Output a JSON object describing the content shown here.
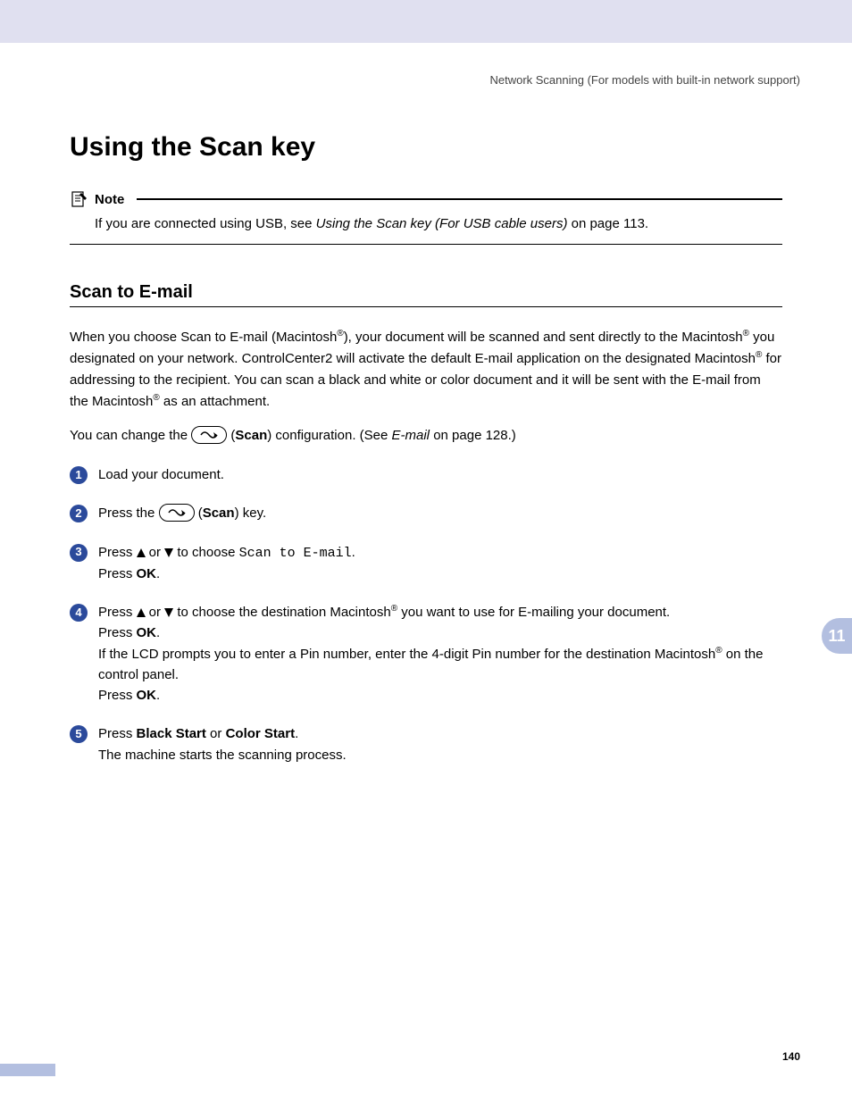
{
  "running_head": "Network Scanning (For models with built-in network support)",
  "title": "Using the Scan key",
  "note": {
    "label": "Note",
    "prefix": "If you are connected using USB, see ",
    "link": "Using the Scan key (For USB cable users)",
    "suffix": " on page 113."
  },
  "subheading": "Scan to E-mail",
  "para1": {
    "t1": "When you choose Scan to E-mail (Macintosh",
    "r1": "®",
    "t2": "), your document will be scanned and sent directly to the Macintosh",
    "r2": "®",
    "t3": " you designated on your network. ControlCenter2 will activate the default E-mail application on the designated Macintosh",
    "r3": "®",
    "t4": " for addressing to the recipient. You can scan a black and white or color document and it will be sent with the E-mail from the Macintosh",
    "r4": "®",
    "t5": " as an attachment."
  },
  "para2": {
    "t1": "You can change the ",
    "t2": " (",
    "scan": "Scan",
    "t3": ") configuration. (See ",
    "link": "E-mail",
    "t4": " on page 128.)"
  },
  "steps": {
    "s1": {
      "num": "1",
      "text": "Load your document."
    },
    "s2": {
      "num": "2",
      "t1": "Press the ",
      "t2": " (",
      "scan": "Scan",
      "t3": ") key."
    },
    "s3": {
      "num": "3",
      "t1": "Press ",
      "t2": " or ",
      "t3": " to choose ",
      "cmd": "Scan to E-mail",
      "dot": ".",
      "line2a": "Press ",
      "ok": "OK",
      "line2b": "."
    },
    "s4": {
      "num": "4",
      "t1": "Press ",
      "t2": " or ",
      "t3": " to choose the destination Macintosh",
      "r1": "®",
      "t4": " you want to use for E-mailing your document.",
      "line2a": "Press ",
      "ok": "OK",
      "line2b": ".",
      "line3a": "If the LCD prompts you to enter a Pin number, enter the 4-digit Pin number for the destination Macintosh",
      "r2": "®",
      "line3b": " on the control panel.",
      "line4a": "Press ",
      "line4b": "."
    },
    "s5": {
      "num": "5",
      "t1": "Press ",
      "b1": "Black Start",
      "t2": " or ",
      "b2": "Color Start",
      "t3": ".",
      "line2": "The machine starts the scanning process."
    }
  },
  "side_tab": "11",
  "page_number": "140"
}
